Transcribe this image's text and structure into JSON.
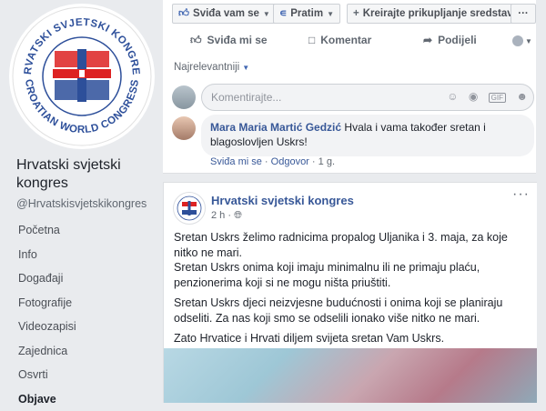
{
  "sidebar": {
    "logo": {
      "arc_top": "HRVATSKI SVJETSKI KONGRES",
      "arc_bottom": "CROATIAN WORLD CONGRESS"
    },
    "page_name": "Hrvatski svjetski kongres",
    "page_handle": "@Hrvatskisvjetskikongres",
    "nav": [
      "Početna",
      "Info",
      "Događaji",
      "Fotografije",
      "Videozapisi",
      "Zajednica",
      "Osvrti",
      "Objave"
    ],
    "active_nav": "Objave"
  },
  "toolbar": {
    "like_label": "Sviđa vam se",
    "follow_label": "Pratim",
    "fundraiser_label": "Kreirajte prikupljanje sredstava",
    "more_label": "···"
  },
  "post_actions": {
    "like": "Sviđa mi se",
    "comment": "Komentar",
    "share": "Podijeli"
  },
  "comments": {
    "sort_label": "Najrelevantniji",
    "input_placeholder": "Komentirajte...",
    "gif_label": "GIF",
    "items": [
      {
        "author": "Mara Maria Martić Gedzić",
        "text": "Hvala i vama također sretan i blagoslovljen Uskrs!",
        "like": "Sviđa mi se",
        "reply": "Odgovor",
        "time": "1 g."
      }
    ]
  },
  "post": {
    "author": "Hrvatski svjetski kongres",
    "time": "2 h",
    "more": "···",
    "paragraphs": [
      "Sretan Uskrs želimo radnicima propalog Uljanika i 3. maja, za koje nitko ne mari.\nSretan Uskrs onima koji imaju minimalnu ili ne primaju plaću, penzionerima koji si ne mogu ništa priuštiti.",
      "Sretan Uskrs djeci neizvjesne budućnosti i onima koji se planiraju odseliti. Za nas koji smo se odselili ionako više nitko ne mari.",
      "Zato Hrvatice i Hrvati diljem svijeta sretan Vam Uskrs."
    ]
  },
  "colors": {
    "link": "#385898",
    "accent": "#4267b2",
    "background": "#e9ebee"
  }
}
